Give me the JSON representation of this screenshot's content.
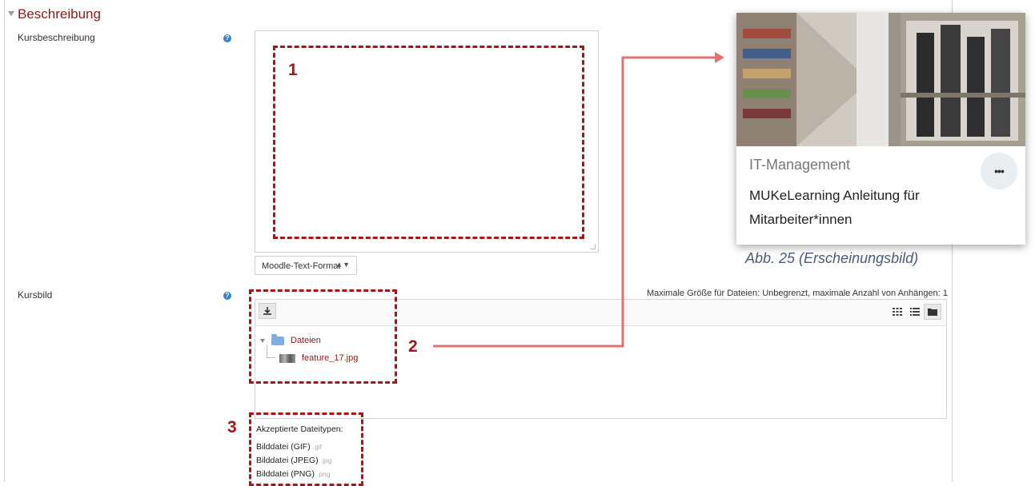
{
  "section": {
    "title": "Beschreibung"
  },
  "fields": {
    "description_label": "Kursbeschreibung",
    "format_select": "Moodle-Text-Format",
    "image_label": "Kursbild"
  },
  "filemanager": {
    "max_info": "Maximale Größe für Dateien: Unbegrenzt, maximale Anzahl von Anhängen: 1",
    "folder": "Dateien",
    "file": "feature_17.jpg"
  },
  "accepted": {
    "heading": "Akzeptierte Dateitypen:",
    "types": [
      {
        "label": "Bilddatei (GIF)",
        "ext": ".gif"
      },
      {
        "label": "Bilddatei (JPEG)",
        "ext": ".jpg"
      },
      {
        "label": "Bilddatei (PNG)",
        "ext": ".png"
      }
    ]
  },
  "callouts": {
    "one": "1",
    "two": "2",
    "three": "3"
  },
  "card": {
    "category": "IT-Management",
    "title": "MUKeLearning Anleitung für Mitarbeiter*innen",
    "menu": "•••"
  },
  "caption": "Abb. 25 (Erscheinungsbild)",
  "colors": {
    "accent": "#8b1b1b",
    "callout": "#a8141a",
    "arrow": "#e07272"
  },
  "icons": [
    "help-icon",
    "upload-icon",
    "grid-view-icon",
    "list-view-icon",
    "folder-view-icon",
    "folder-icon",
    "image-thumb-icon",
    "more-icon"
  ]
}
